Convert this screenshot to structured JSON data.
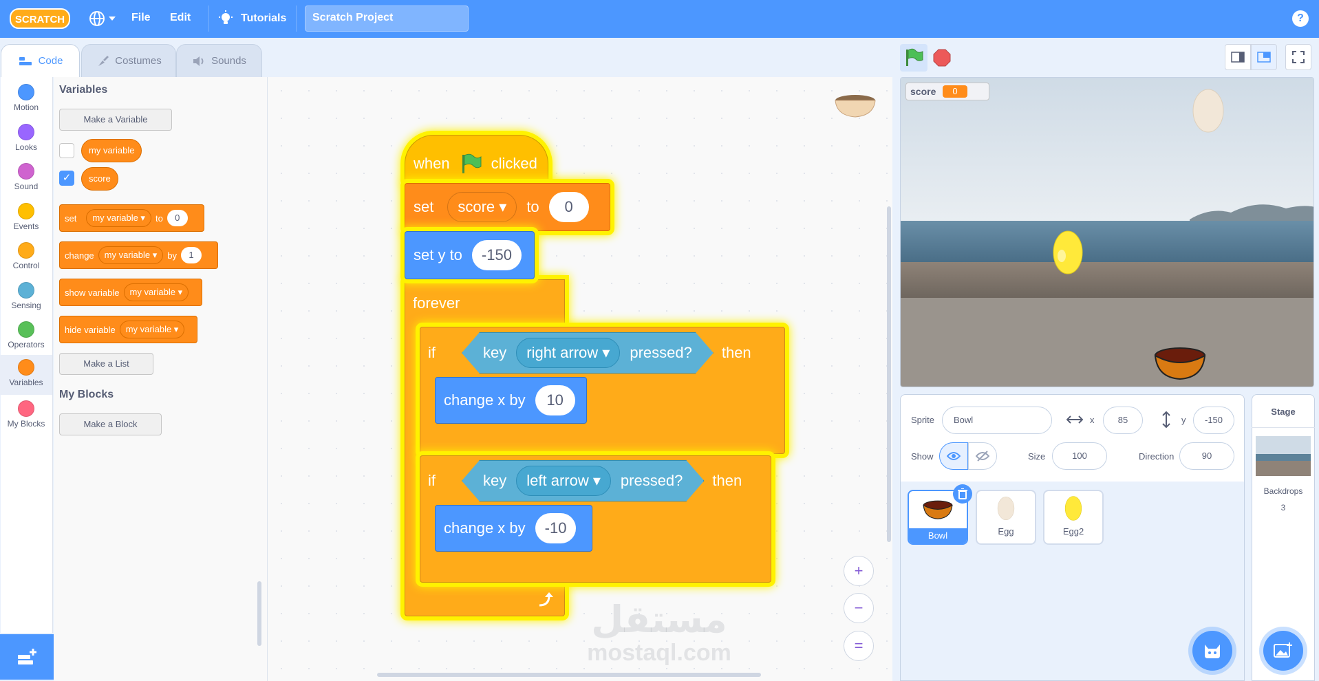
{
  "menubar": {
    "logo_text": "SCRATCH",
    "file": "File",
    "edit": "Edit",
    "tutorials": "Tutorials",
    "project_title": "Scratch Project",
    "help": "?"
  },
  "tabs": {
    "code": "Code",
    "costumes": "Costumes",
    "sounds": "Sounds"
  },
  "categories": [
    {
      "label": "Motion",
      "color": "#4c97ff"
    },
    {
      "label": "Looks",
      "color": "#9966ff"
    },
    {
      "label": "Sound",
      "color": "#cf63cf"
    },
    {
      "label": "Events",
      "color": "#ffbf00"
    },
    {
      "label": "Control",
      "color": "#ffab19"
    },
    {
      "label": "Sensing",
      "color": "#5cb1d6"
    },
    {
      "label": "Operators",
      "color": "#59c059"
    },
    {
      "label": "Variables",
      "color": "#ff8c1a"
    },
    {
      "label": "My Blocks",
      "color": "#ff6680"
    }
  ],
  "flyout": {
    "variables_heading": "Variables",
    "make_variable": "Make a Variable",
    "var1": "my variable",
    "var2": "score",
    "set_block": {
      "verb": "set",
      "var": "my variable",
      "to": "to",
      "value": "0"
    },
    "change_block": {
      "verb": "change",
      "var": "my variable",
      "by": "by",
      "value": "1"
    },
    "show_block": {
      "verb": "show variable",
      "var": "my variable"
    },
    "hide_block": {
      "verb": "hide variable",
      "var": "my variable"
    },
    "make_list": "Make a List",
    "myblocks_heading": "My Blocks",
    "make_block": "Make a Block"
  },
  "script": {
    "hat": {
      "when": "when",
      "clicked": "clicked"
    },
    "set_score": {
      "set": "set",
      "var": "score",
      "to": "to",
      "value": "0"
    },
    "set_y": {
      "label": "set y to",
      "value": "-150"
    },
    "forever": "forever",
    "if1": {
      "if": "if",
      "key": "key",
      "key_name": "right arrow",
      "pressed": "pressed?",
      "then": "then"
    },
    "change1": {
      "label": "change x by",
      "value": "10"
    },
    "if2": {
      "if": "if",
      "key": "key",
      "key_name": "left arrow",
      "pressed": "pressed?",
      "then": "then"
    },
    "change2": {
      "label": "change x by",
      "value": "-10"
    }
  },
  "zoom": {
    "in": "+",
    "out": "−",
    "reset": "="
  },
  "stage": {
    "monitor_label": "score",
    "monitor_value": "0"
  },
  "sprite_info": {
    "sprite_label": "Sprite",
    "sprite_name": "Bowl",
    "x_label": "x",
    "x_value": "85",
    "y_label": "y",
    "y_value": "-150",
    "show_label": "Show",
    "size_label": "Size",
    "size_value": "100",
    "direction_label": "Direction",
    "direction_value": "90"
  },
  "sprites": [
    {
      "name": "Bowl",
      "selected": true
    },
    {
      "name": "Egg",
      "selected": false
    },
    {
      "name": "Egg2",
      "selected": false
    }
  ],
  "stage_pane": {
    "title": "Stage",
    "backdrops_label": "Backdrops",
    "backdrops_count": "3"
  },
  "watermark": {
    "arabic": "مستقل",
    "latin": "mostaql.com"
  }
}
